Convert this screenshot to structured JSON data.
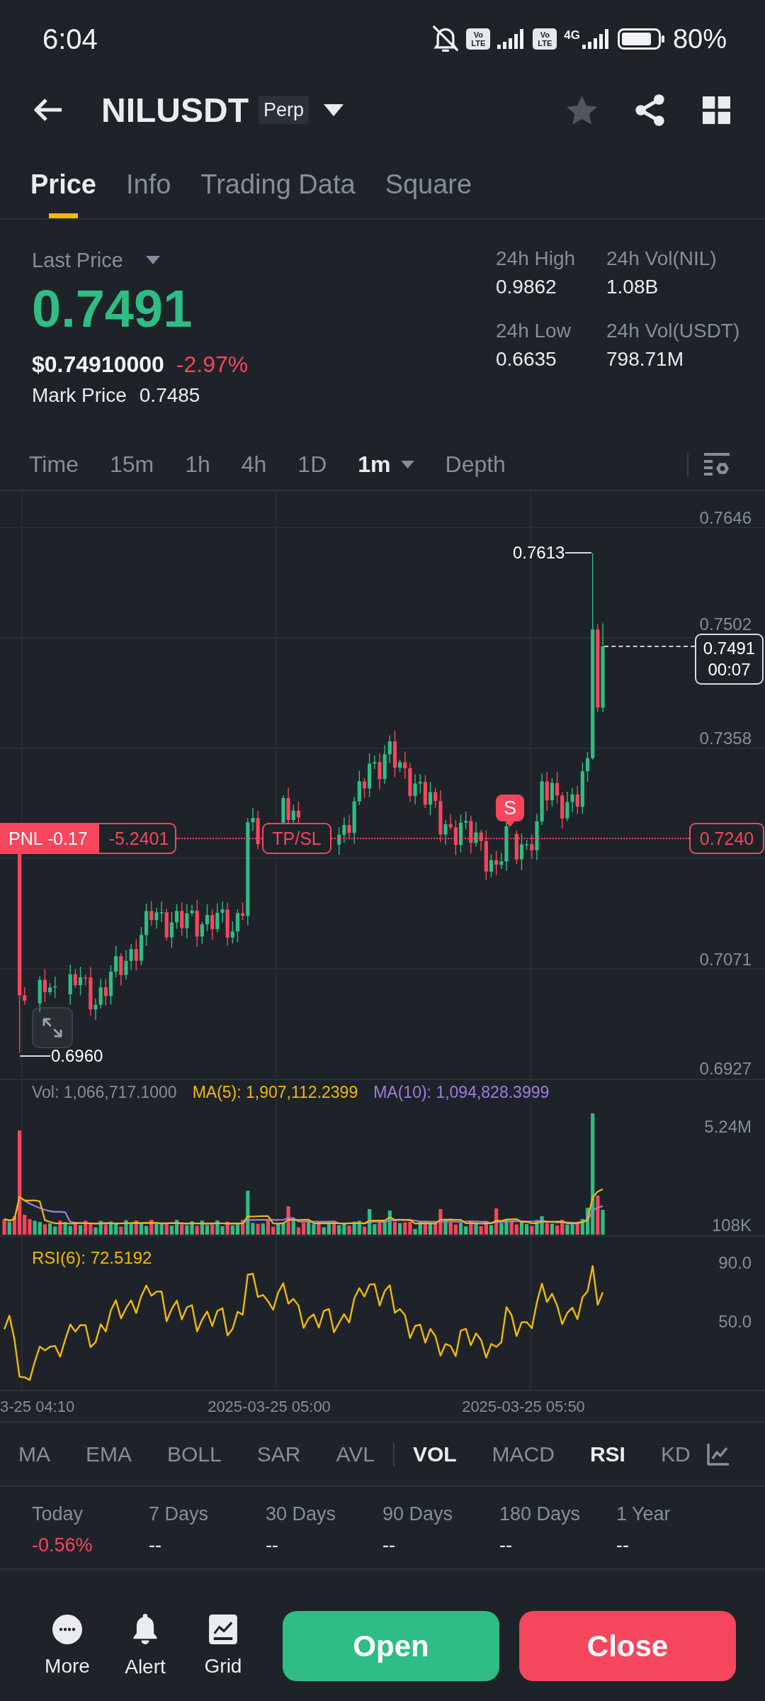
{
  "status_bar": {
    "time": "6:04",
    "sim_badges": [
      {
        "top": "Vo",
        "bottom": "LTE"
      },
      {
        "top": "Vo",
        "bottom": "LTE"
      }
    ],
    "network": "4G",
    "battery": "80%"
  },
  "header": {
    "symbol": "NILUSDT",
    "badge": "Perp",
    "favorited": false
  },
  "tabs": [
    {
      "label": "Price",
      "selected": true
    },
    {
      "label": "Info",
      "selected": false
    },
    {
      "label": "Trading Data",
      "selected": false
    },
    {
      "label": "Square",
      "selected": false
    }
  ],
  "price": {
    "label": "Last Price",
    "last": {
      "value": "0.7491",
      "negative": false
    },
    "usd": "$0.74910000",
    "change": {
      "value": "-2.97%",
      "negative": true
    },
    "mark_label": "Mark Price",
    "mark_value": "0.7485"
  },
  "stats": [
    {
      "label": "24h High",
      "value": "0.9862"
    },
    {
      "label": "24h Vol(NIL)",
      "value": "1.08B"
    },
    {
      "label": "24h Low",
      "value": "0.6635"
    },
    {
      "label": "24h Vol(USDT)",
      "value": "798.71M"
    }
  ],
  "intervals": [
    {
      "label": "Time",
      "selected": false,
      "dropdown": false
    },
    {
      "label": "15m",
      "selected": false,
      "dropdown": false
    },
    {
      "label": "1h",
      "selected": false,
      "dropdown": false
    },
    {
      "label": "4h",
      "selected": false,
      "dropdown": false
    },
    {
      "label": "1D",
      "selected": false,
      "dropdown": false
    },
    {
      "label": "1m",
      "selected": true,
      "dropdown": true
    },
    {
      "label": "Depth",
      "selected": false,
      "dropdown": false
    }
  ],
  "chart": {
    "price_axis": [
      "0.7646",
      "0.7502",
      "0.7358",
      "0.7071",
      "0.6927"
    ],
    "high": "0.7613",
    "low": "0.6960",
    "current_price": "0.7491",
    "countdown": "00:07",
    "position": {
      "pnl": "PNL -0.17",
      "value": "-5.2401",
      "tpsl": "TP/SL",
      "entry": "0.7240"
    },
    "trade_marker": "S"
  },
  "volume": {
    "vol": "Vol: 1,066,717.1000",
    "ma5": "MA(5): 1,907,112.2399",
    "ma10": "MA(10): 1,094,828.3999",
    "axis": [
      "5.24M",
      "108K"
    ]
  },
  "rsi": {
    "label": "RSI(6): 72.5192",
    "axis": [
      "90.0",
      "50.0"
    ]
  },
  "time_axis": [
    "3-25 04:10",
    "2025-03-25 05:00",
    "2025-03-25 05:50"
  ],
  "indicators": {
    "main": [
      {
        "label": "MA",
        "selected": false
      },
      {
        "label": "EMA",
        "selected": false
      },
      {
        "label": "BOLL",
        "selected": false
      },
      {
        "label": "SAR",
        "selected": false
      },
      {
        "label": "AVL",
        "selected": false
      }
    ],
    "sub": [
      {
        "label": "VOL",
        "selected": true
      },
      {
        "label": "MACD",
        "selected": false
      },
      {
        "label": "RSI",
        "selected": true
      },
      {
        "label": "KD",
        "selected": false
      }
    ]
  },
  "performance": [
    {
      "label": "Today",
      "value": "-0.56%",
      "color": "#f6465d"
    },
    {
      "label": "7 Days",
      "value": "--",
      "color": "#eaecef"
    },
    {
      "label": "30 Days",
      "value": "--",
      "color": "#eaecef"
    },
    {
      "label": "90 Days",
      "value": "--",
      "color": "#eaecef"
    },
    {
      "label": "180 Days",
      "value": "--",
      "color": "#eaecef"
    },
    {
      "label": "1 Year",
      "value": "--",
      "color": "#eaecef"
    }
  ],
  "actions": [
    {
      "label": "More",
      "kind": "more"
    },
    {
      "label": "Alert",
      "kind": "alert"
    },
    {
      "label": "Grid",
      "kind": "grid"
    }
  ],
  "buttons": [
    {
      "label": "Open",
      "kind": "open"
    },
    {
      "label": "Close",
      "kind": "close"
    }
  ]
}
